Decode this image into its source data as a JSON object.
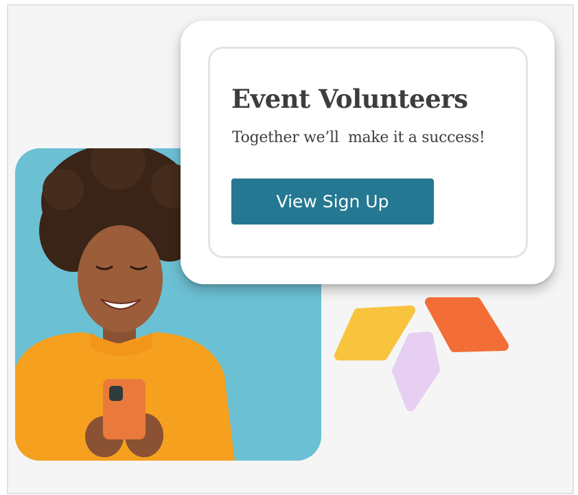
{
  "card": {
    "title": "Event Volunteers",
    "subtitle": "Together we’ll  make it a success!",
    "button_label": "View Sign Up"
  },
  "colors": {
    "accent": "#247891",
    "photo_background": "#6cc0d3",
    "petal_yellow": "#f8c33d",
    "petal_orange": "#f26e36",
    "petal_lavender": "#e7cff2"
  },
  "photo": {
    "subject": "smiling-woman-holding-phone"
  },
  "icons": [
    "petal-cluster-icon"
  ]
}
